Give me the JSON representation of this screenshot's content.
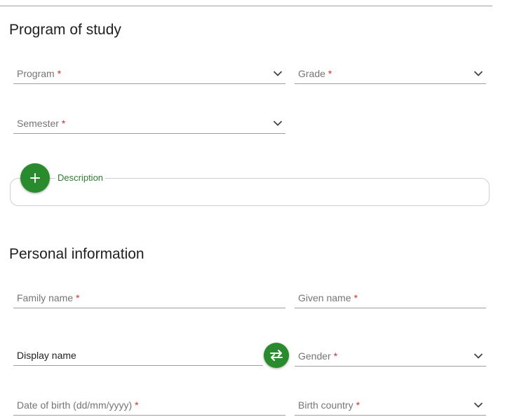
{
  "program_section": {
    "title": "Program of study",
    "program": {
      "label": "Program",
      "required_mark": "*"
    },
    "grade": {
      "label": "Grade",
      "required_mark": "*"
    },
    "semester": {
      "label": "Semester",
      "required_mark": "*"
    },
    "description": {
      "label": "Description"
    },
    "add_button_icon": "plus-icon"
  },
  "personal_section": {
    "title": "Personal information",
    "family_name": {
      "label": "Family name",
      "required_mark": "*"
    },
    "given_name": {
      "label": "Given name",
      "required_mark": "*"
    },
    "display_name": {
      "label": "Display name"
    },
    "gender": {
      "label": "Gender",
      "required_mark": "*"
    },
    "date_of_birth": {
      "label": "Date of birth (dd/mm/yyyy)",
      "required_mark": "*"
    },
    "birth_country": {
      "label": "Birth country",
      "required_mark": "*"
    },
    "swap_button_icon": "swap-arrows-icon"
  },
  "colors": {
    "accent": "#2a8a2e",
    "accent_text": "#2e7d32",
    "required": "#d32f2f",
    "underline": "#9e9e9e",
    "placeholder": "#757575"
  }
}
